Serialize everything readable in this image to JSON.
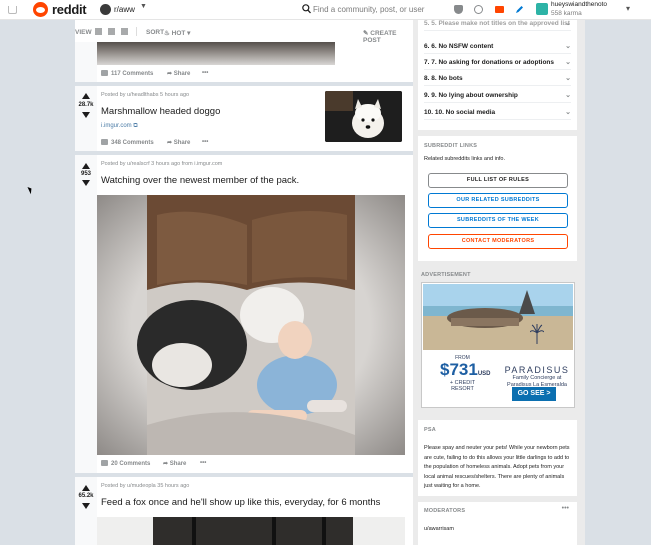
{
  "header": {
    "app_name": "reddit",
    "subreddit": "r/aww",
    "search_placeholder": "Find a community, post, or user",
    "user_name": "hueyswiandthenoto",
    "karma": "558 karma"
  },
  "view_bar": {
    "view_label": "VIEW",
    "sort_label": "SORT",
    "sort_value": "HOT",
    "create_post": "CREATE POST"
  },
  "posts": [
    {
      "comments": "117 Comments",
      "share": "Share",
      "more": "•••"
    },
    {
      "score": "28.7k",
      "meta": "Posted by u/headlthabs 5 hours ago",
      "title": "Marshmallow headed doggo",
      "domain": "i.imgur.com",
      "comments": "348 Comments",
      "share": "Share",
      "more": "•••"
    },
    {
      "score": "953",
      "meta": "Posted by u/realscrf 3 hours ago from i.imgur.com",
      "title": "Watching over the newest member of the pack.",
      "comments": "20 Comments",
      "share": "Share",
      "more": "•••"
    },
    {
      "score": "65.2k",
      "meta": "Posted by u/mudeopla 35 hours ago",
      "title": "Feed a fox once and he'll show up like this, everyday, for 6 months"
    }
  ],
  "sidebar": {
    "rules": [
      {
        "label": "5. 5. Please make not titles on the approved list"
      },
      {
        "label": "6. 6. No NSFW content"
      },
      {
        "label": "7. 7. No asking for donations or adoptions"
      },
      {
        "label": "8. 8. No bots"
      },
      {
        "label": "9. 9. No lying about ownership"
      },
      {
        "label": "10. 10. No social media"
      }
    ],
    "links_heading": "SUBREDDIT LINKS",
    "links_desc": "Related subreddits links and info.",
    "buttons": [
      {
        "label": "FULL LIST OF RULES",
        "color": "#1c1c1c"
      },
      {
        "label": "OUR RELATED SUBREDDITS",
        "color": "#0079d3"
      },
      {
        "label": "SUBREDDITS OF THE WEEK",
        "color": "#0079d3"
      },
      {
        "label": "CONTACT MODERATORS",
        "color": "#ff4500"
      }
    ],
    "ad_heading": "ADVERTISEMENT",
    "ad": {
      "from": "FROM",
      "price": "$731",
      "currency": "USD",
      "credit": "+ CREDIT RESORT",
      "brand": "PARADISUS",
      "tagline1": "Family Concierge at",
      "tagline2": "Paradisus La Esmeralda",
      "cta": "GO SEE >"
    },
    "psa_heading": "PSA",
    "psa_text": "Please spay and neuter your pets! While your newborn pets are cute, failing to do this allows your little darlings to add to the population of homeless animals. Adopt pets from your local animal rescues/shelters. There are plenty of animals just waiting for a home.",
    "moderators_heading": "MODERATORS",
    "moderator_1": "u/awarrisam"
  }
}
